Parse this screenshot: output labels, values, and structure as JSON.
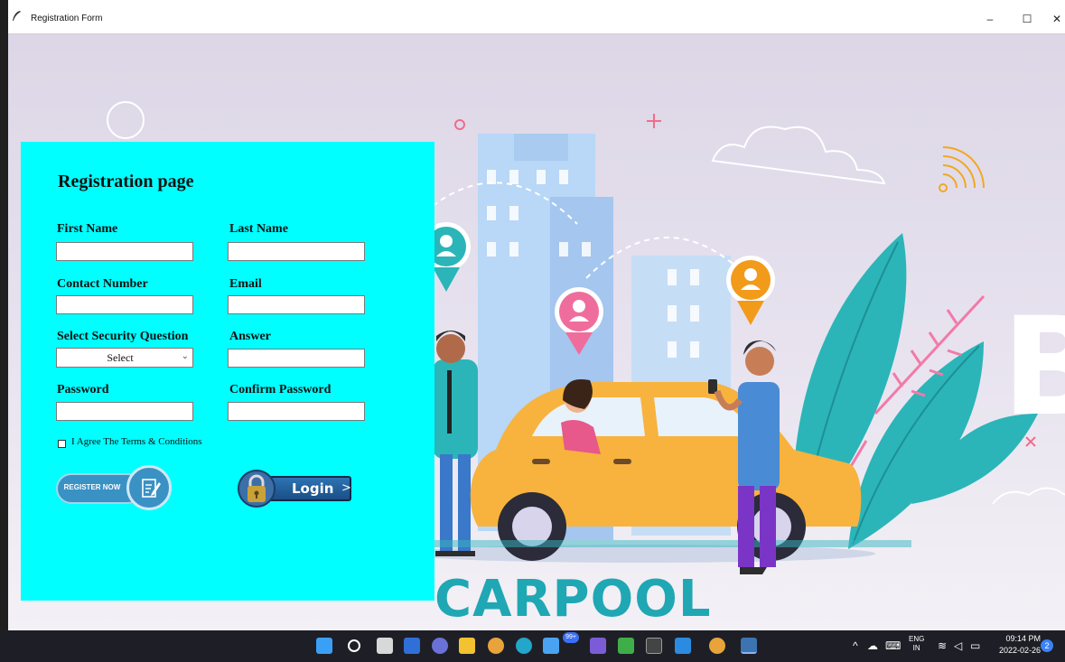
{
  "window": {
    "title": "Registration Form",
    "controls": {
      "minimize": "–",
      "maximize": "☐",
      "close": "✕"
    }
  },
  "form": {
    "heading": "Registration page",
    "first_name_label": "First Name",
    "last_name_label": "Last Name",
    "contact_label": "Contact Number",
    "email_label": "Email",
    "security_question_label": "Select Security Question",
    "security_question_value": "Select",
    "answer_label": "Answer",
    "password_label": "Password",
    "confirm_password_label": "Confirm Password",
    "terms_label": "I Agree The Terms & Conditions",
    "register_button_label": "REGISTER NOW",
    "login_button_label": "Login",
    "login_arrow": ">"
  },
  "background": {
    "brand_text": "CARPOOL",
    "colors": {
      "panel": "#00ffff",
      "brand": "#1fa7b4"
    }
  },
  "taskbar": {
    "icons": [
      "windows-start-icon",
      "search-icon",
      "task-view-icon",
      "widgets-icon",
      "teams-chat-icon",
      "file-explorer-icon",
      "chrome-icon",
      "edge-icon",
      "store-icon",
      "onenote-icon",
      "xbox-icon",
      "epic-games-icon",
      "vscode-icon",
      "chrome-profile-icon",
      "python-icon"
    ],
    "store_badge": "99+",
    "language": "ENG",
    "region": "IN",
    "time": "09:14 PM",
    "date": "2022-02-26",
    "notification_count": "2"
  }
}
